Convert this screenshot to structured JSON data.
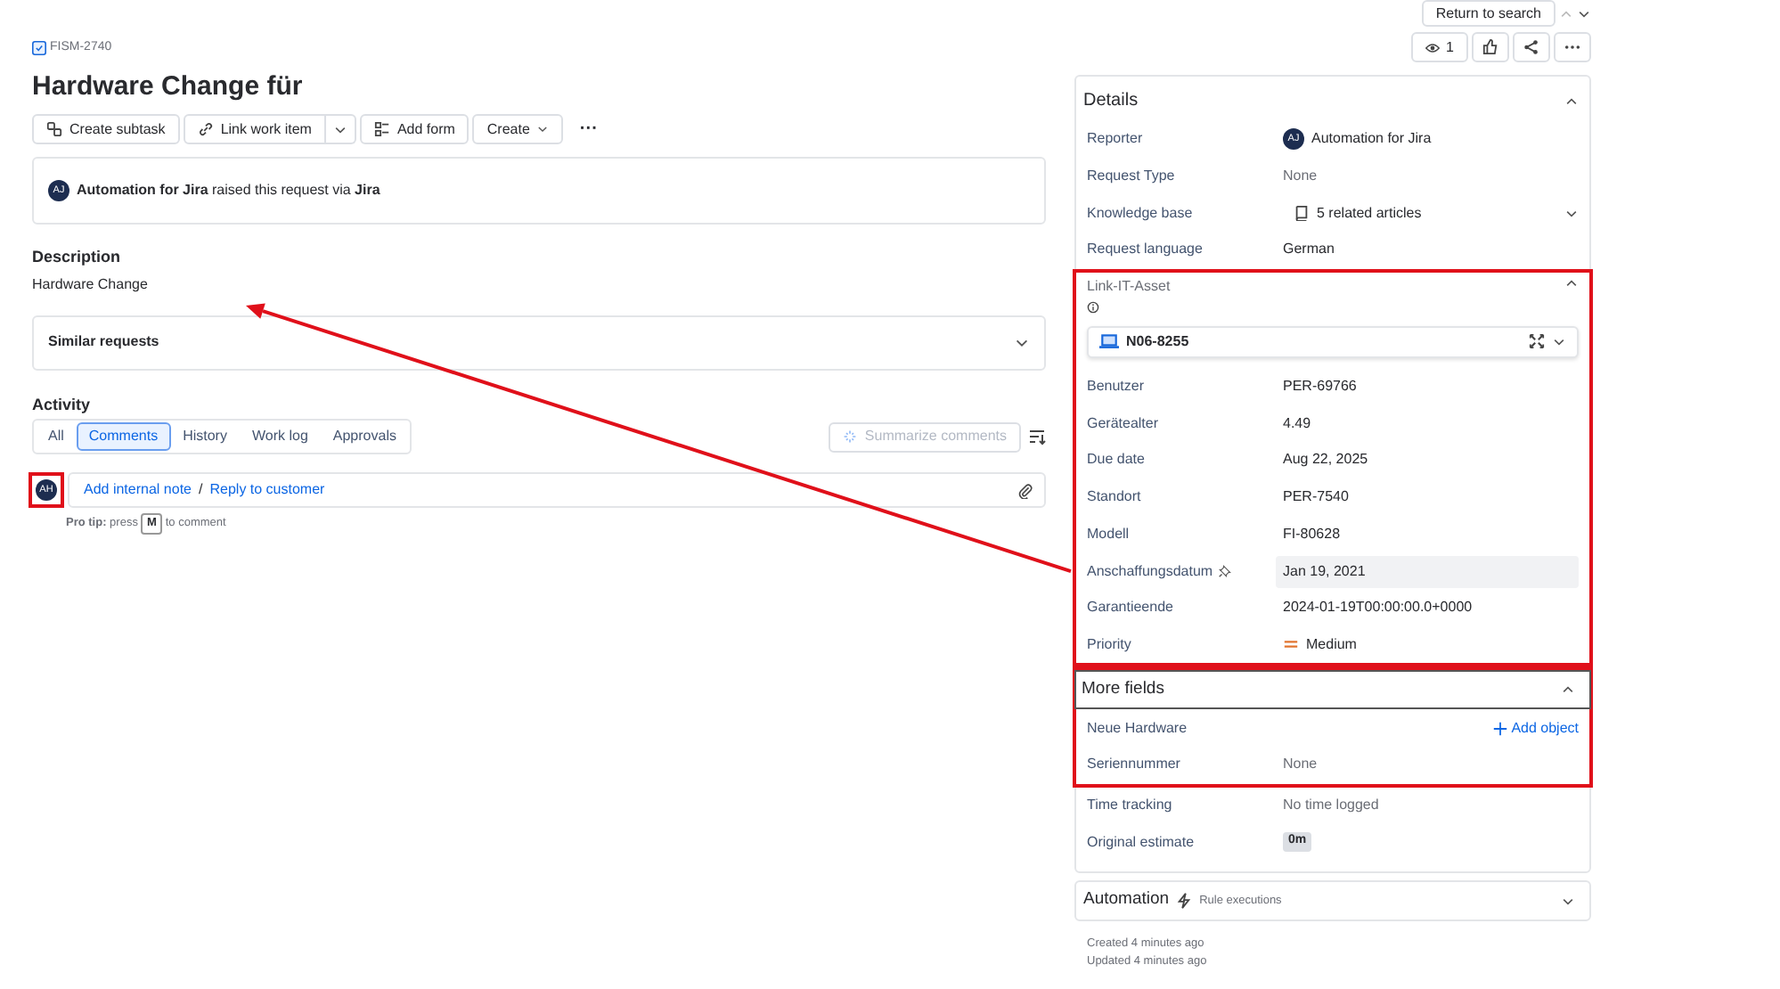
{
  "issue_key": "FISM-2740",
  "title": "Hardware Change für",
  "toolbar": [
    {
      "label": "Create subtask",
      "kind": "subtask"
    },
    {
      "label": "Link work item",
      "kind": "link-split"
    },
    {
      "label": "Add form",
      "kind": "form"
    },
    {
      "label": "Create",
      "kind": "dropdown"
    },
    {
      "label": "···",
      "kind": "more"
    }
  ],
  "request": {
    "avatar": "AJ",
    "text": "**Automation for Jira** raised this request via **Jira**"
  },
  "description": {
    "heading": "Description",
    "text": "Hardware Change"
  },
  "similar_requests": {
    "label": "Similar requests",
    "expanded": false
  },
  "activity": {
    "heading": "Activity",
    "tabs": [
      {
        "label": "All",
        "selected": false
      },
      {
        "label": "Comments",
        "selected": true
      },
      {
        "label": "History",
        "selected": false
      },
      {
        "label": "Work log",
        "selected": false
      },
      {
        "label": "Approvals",
        "selected": false
      }
    ],
    "summarize": {
      "label": "Summarize comments",
      "disabled": true
    },
    "comment": {
      "avatar": "AH",
      "avatar_highlighted": true,
      "internal_note": "Add internal note",
      "separator": "/",
      "reply": "Reply to customer"
    },
    "pro_tip": {
      "before": "**Pro tip:** press",
      "key": "M",
      "after": "to comment"
    }
  },
  "top_actions": {
    "return": "Return to search",
    "previous_disabled": true,
    "watchers": "1"
  },
  "details": {
    "heading": "Details",
    "expanded": true,
    "sections": [
      {
        "highlighted": false,
        "rows": [
          {
            "label": "Reporter",
            "kind": "avatar",
            "avatar": "AJ",
            "value": "Automation for Jira"
          },
          {
            "label": "Request Type",
            "kind": "muted",
            "value": "None"
          },
          {
            "label": "Knowledge base",
            "kind": "kb",
            "value": "5 related articles"
          },
          {
            "label": "Request language",
            "kind": "text",
            "value": "German"
          }
        ]
      },
      {
        "highlighted": true,
        "header": {
          "label": "Link-IT-Asset",
          "kind": "field"
        },
        "asset": "N06-8255",
        "rows": [
          {
            "label": "Benutzer",
            "kind": "text",
            "value": "PER-69766"
          },
          {
            "label": "Gerätealter",
            "kind": "text",
            "value": "4.49"
          },
          {
            "label": "Due date",
            "kind": "text",
            "value": "Aug 22, 2025"
          },
          {
            "label": "Standort",
            "kind": "text",
            "value": "PER-7540"
          },
          {
            "label": "Modell",
            "kind": "text",
            "value": "FI-80628"
          },
          {
            "label": "Anschaffungsdatum",
            "kind": "hover",
            "pinned": true,
            "value": "Jan 19, 2021"
          },
          {
            "label": "Garantieende",
            "kind": "text",
            "value": "2024-01-19T00:00:00.0+0000"
          },
          {
            "label": "Priority",
            "kind": "priority",
            "value": "Medium"
          }
        ]
      },
      {
        "highlighted": true,
        "header": {
          "label": "More fields",
          "kind": "section"
        },
        "rows": [
          {
            "label": "Neue Hardware",
            "kind": "add",
            "value": "Add object"
          },
          {
            "label": "Seriennummer",
            "kind": "muted",
            "value": "None"
          }
        ]
      },
      {
        "highlighted": false,
        "rows": [
          {
            "label": "Time tracking",
            "kind": "muted",
            "value": "No time logged"
          },
          {
            "label": "Original estimate",
            "kind": "badge",
            "value": "0m"
          }
        ]
      }
    ]
  },
  "automation": {
    "heading": "Automation",
    "subtitle": "Rule executions"
  },
  "created": "Created 4 minutes ago",
  "updated": "Updated 4 minutes ago",
  "annotation_arrow": true
}
